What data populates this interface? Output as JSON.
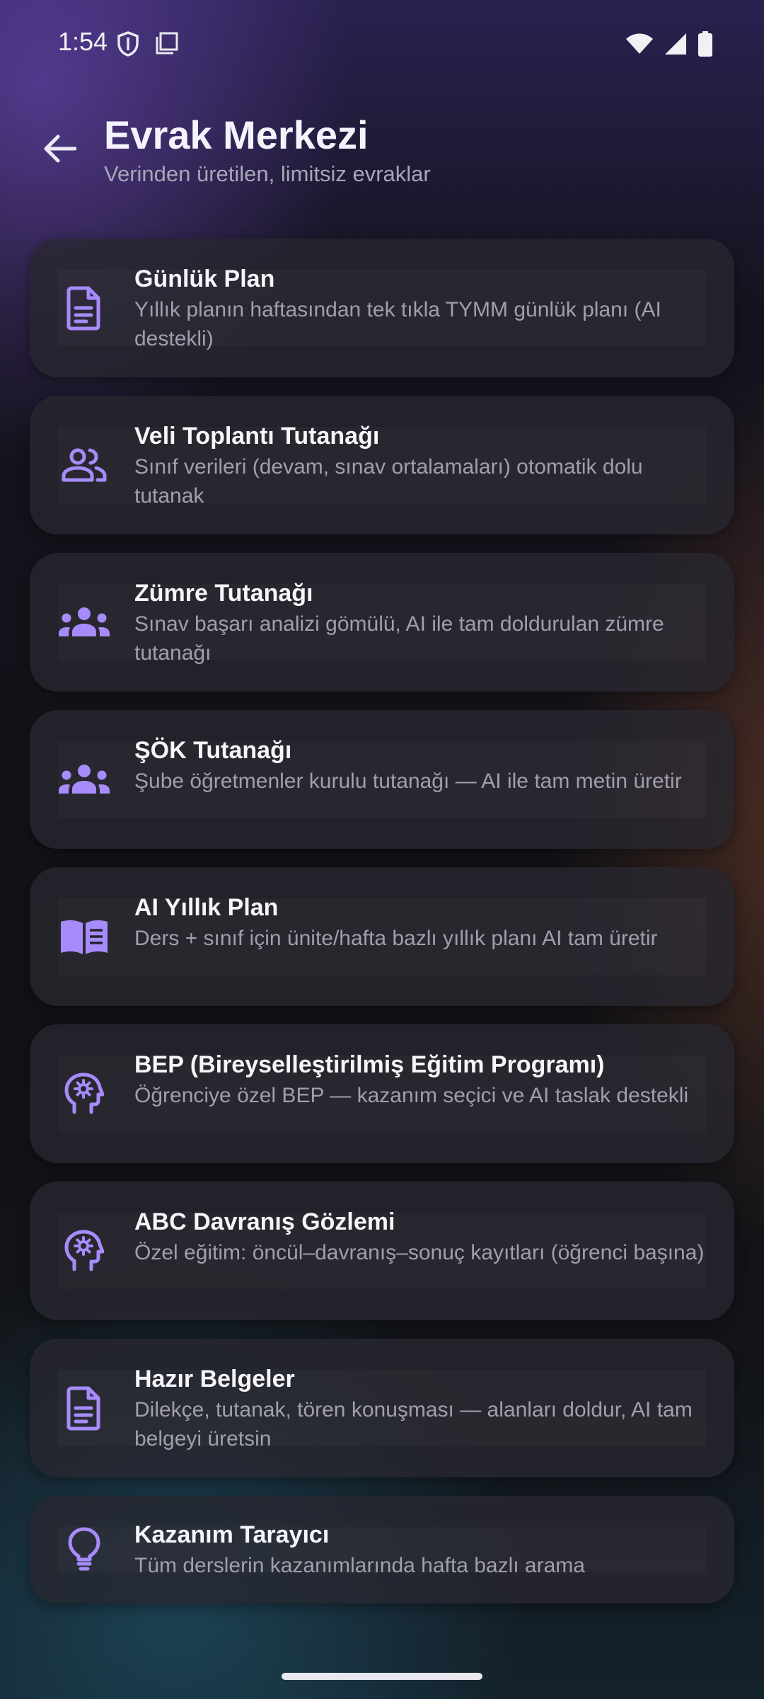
{
  "status_bar": {
    "time": "1:54",
    "left_icons": [
      "shield-icon",
      "screen-icon"
    ],
    "right_icons": [
      "wifi-icon",
      "cellular-signal-icon",
      "battery-icon"
    ]
  },
  "header": {
    "back_icon": "arrow-back-icon",
    "title": "Evrak Merkezi",
    "subtitle": "Verinden üretilen, limitsiz evraklar"
  },
  "accent_color": "#a78bfa",
  "cards": [
    {
      "icon": "document-icon",
      "title": "Günlük Plan",
      "description": "Yıllık planın haftasından tek tıkla TYMM günlük planı (AI destekli)"
    },
    {
      "icon": "people-icon",
      "title": "Veli Toplantı Tutanağı",
      "description": "Sınıf verileri (devam, sınav ortalamaları) otomatik dolu tutanak"
    },
    {
      "icon": "groups-icon",
      "title": "Zümre Tutanağı",
      "description": "Sınav başarı analizi gömülü, AI ile tam doldurulan zümre tutanağı"
    },
    {
      "icon": "groups-icon",
      "title": "ŞÖK Tutanağı",
      "description": "Şube öğretmenler kurulu tutanağı — AI ile tam metin üretir"
    },
    {
      "icon": "open-book-icon",
      "title": "AI Yıllık Plan",
      "description": "Ders + sınıf için ünite/hafta bazlı yıllık planı AI tam üretir"
    },
    {
      "icon": "psychology-icon",
      "title": "BEP (Bireyselleştirilmiş Eğitim Programı)",
      "description": "Öğrenciye özel BEP — kazanım seçici ve AI taslak destekli"
    },
    {
      "icon": "psychology-icon",
      "title": "ABC Davranış Gözlemi",
      "description": "Özel eğitim: öncül–davranış–sonuç kayıtları (öğrenci başına)"
    },
    {
      "icon": "document-icon",
      "title": "Hazır Belgeler",
      "description": "Dilekçe, tutanak, tören konuşması — alanları doldur, AI tam belgeyi üretsin"
    },
    {
      "icon": "lightbulb-icon",
      "title": "Kazanım Tarayıcı",
      "description": "Tüm derslerin kazanımlarında hafta bazlı arama"
    }
  ]
}
